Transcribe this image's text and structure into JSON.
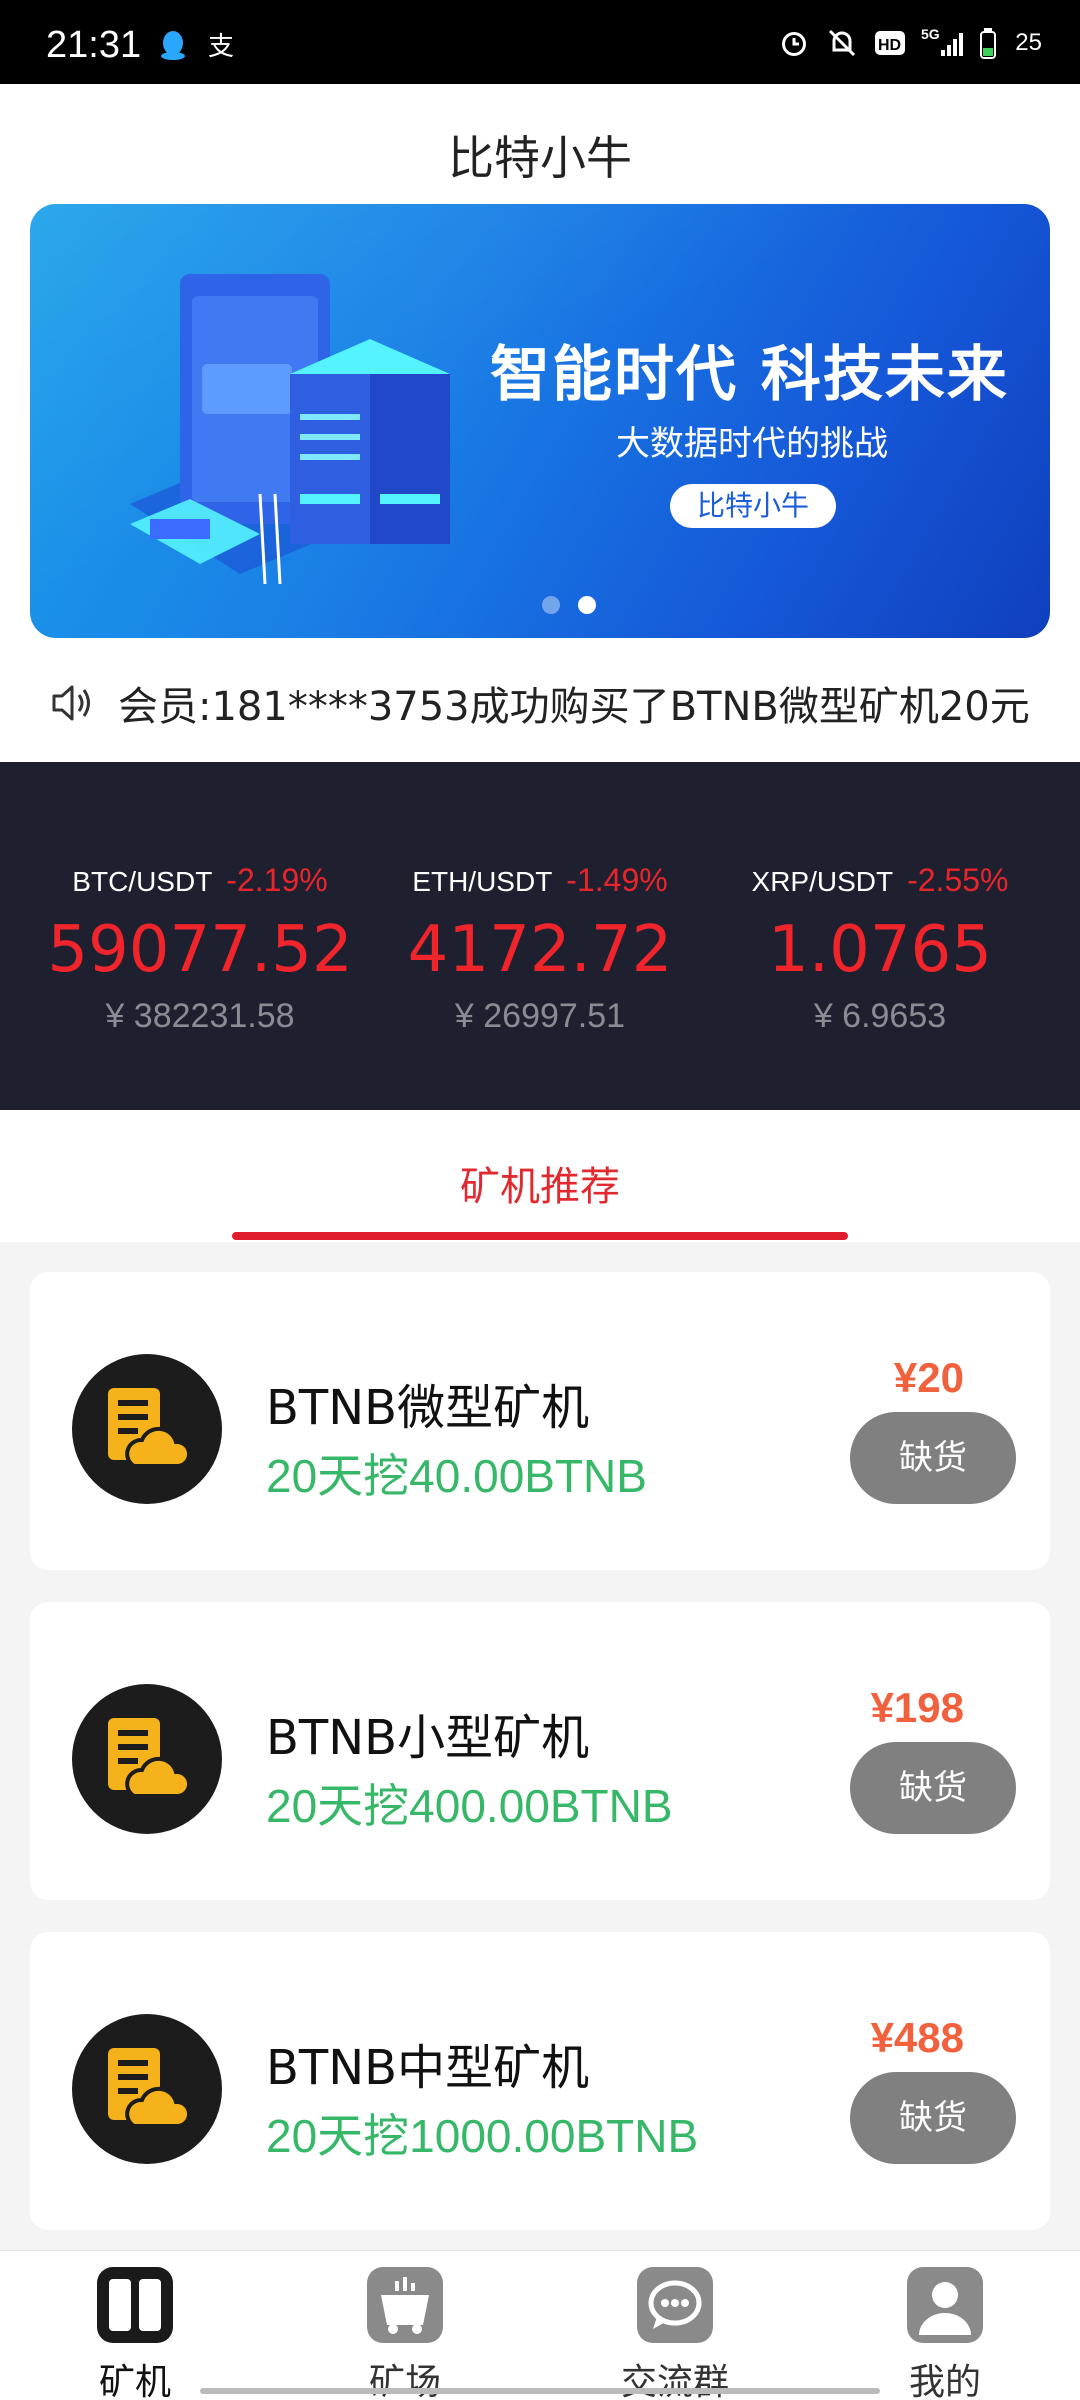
{
  "status_bar": {
    "time": "21:31",
    "battery": "25",
    "network": "5G",
    "icons": [
      "qq-icon",
      "alipay-icon",
      "alarm-icon",
      "mute-icon",
      "hd-icon",
      "signal-icon",
      "battery-icon"
    ]
  },
  "header": {
    "title": "比特小牛"
  },
  "banner": {
    "headline": "智能时代 科技未来",
    "subtitle": "大数据时代的挑战",
    "button_label": "比特小牛",
    "slides": 2,
    "active_slide": 2
  },
  "notice": {
    "icon": "speaker-icon",
    "text": "会员:181****3753成功购买了BTNB微型矿机20元"
  },
  "ticker": [
    {
      "pair": "BTC/USDT",
      "change": "-2.19%",
      "price": "59077.52",
      "cny": "¥ 382231.58"
    },
    {
      "pair": "ETH/USDT",
      "change": "-1.49%",
      "price": "4172.72",
      "cny": "¥ 26997.51"
    },
    {
      "pair": "XRP/USDT",
      "change": "-2.55%",
      "price": "1.0765",
      "cny": "¥ 6.9653"
    }
  ],
  "tabs": {
    "active_label": "矿机推荐"
  },
  "products": [
    {
      "name": "BTNB微型矿机",
      "yield": "20天挖40.00BTNB",
      "price": "¥20",
      "button": "缺货"
    },
    {
      "name": "BTNB小型矿机",
      "yield": "20天挖400.00BTNB",
      "price": "¥198",
      "button": "缺货"
    },
    {
      "name": "BTNB中型矿机",
      "yield": "20天挖1000.00BTNB",
      "price": "¥488",
      "button": "缺货"
    }
  ],
  "bottom_nav": [
    {
      "label": "矿机",
      "icon": "miner-icon",
      "active": true
    },
    {
      "label": "矿场",
      "icon": "mine-cart-icon",
      "active": false
    },
    {
      "label": "交流群",
      "icon": "chat-icon",
      "active": false
    },
    {
      "label": "我的",
      "icon": "user-icon",
      "active": false
    }
  ],
  "colors": {
    "accent_red": "#e01d2d",
    "ticker_bg": "#1e2030",
    "price_red": "#f0242b",
    "yield_green": "#36b868",
    "price_orange": "#f2613d",
    "button_gray": "#808080"
  }
}
